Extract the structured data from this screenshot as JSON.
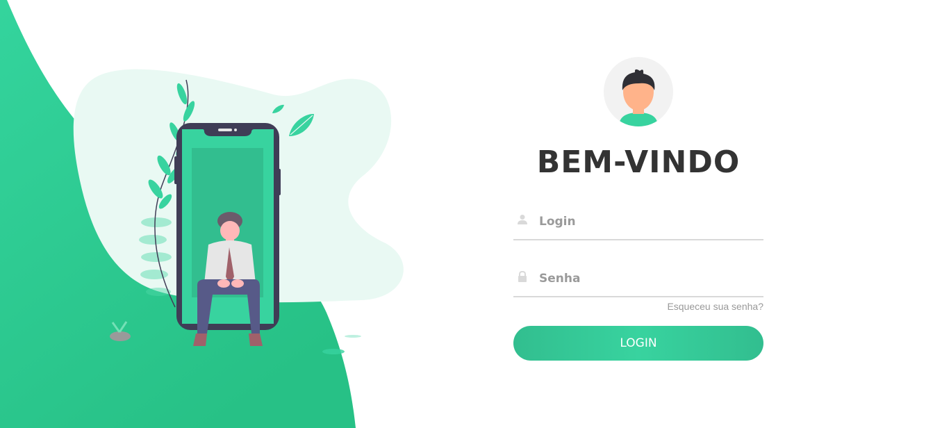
{
  "login_panel": {
    "title": "BEM-VINDO",
    "username": {
      "placeholder": "Login",
      "value": "",
      "icon": "user-icon"
    },
    "password": {
      "placeholder": "Senha",
      "value": "",
      "icon": "lock-icon"
    },
    "forgot_password": "Esqueceu sua senha?",
    "submit_label": "LOGIN"
  },
  "colors": {
    "accent": "#38d39f",
    "accent_dark": "#2bc48d",
    "phone_frame": "#3f3d56",
    "title_text": "#333333"
  }
}
